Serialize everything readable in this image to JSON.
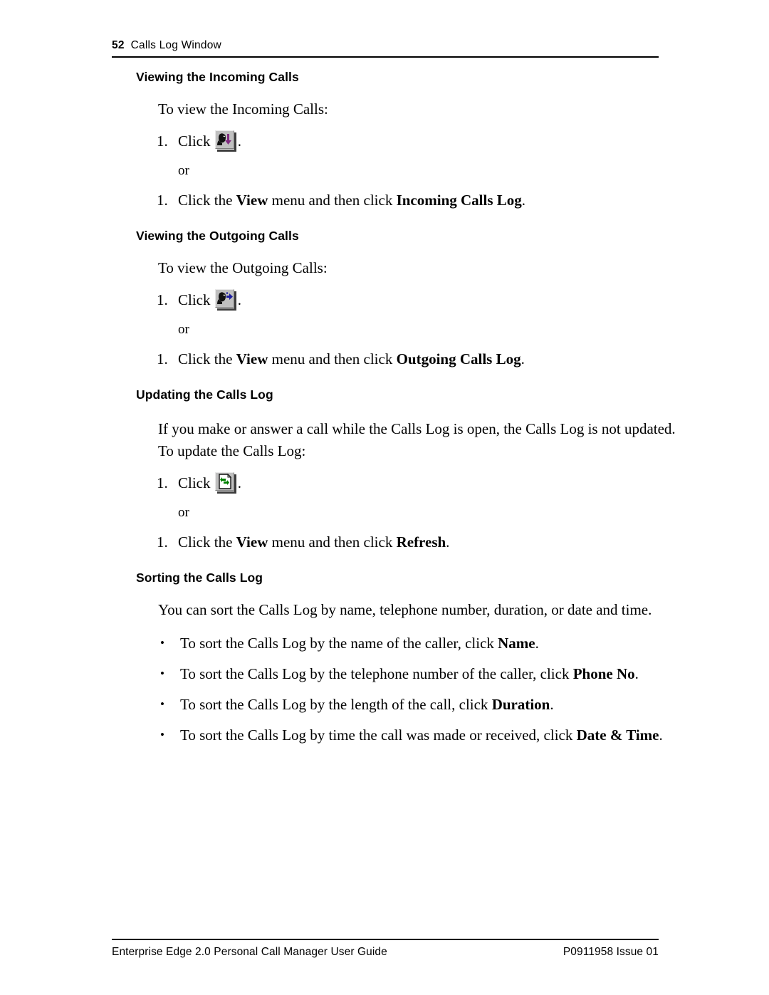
{
  "header": {
    "page_number": "52",
    "chapter_title": "Calls Log Window"
  },
  "sections": [
    {
      "heading": "Viewing the Incoming Calls",
      "intro": "To view the Incoming Calls:",
      "step_number": "1.",
      "step_click_label": "Click",
      "step_trailing": ".",
      "icon": "incoming-calls-log-icon",
      "or_label": "or",
      "alt_step_number": "1.",
      "alt_step_prefix": "Click the ",
      "alt_step_bold_1": "View",
      "alt_step_middle": " menu and then click ",
      "alt_step_bold_2": "Incoming Calls Log",
      "alt_step_suffix": "."
    },
    {
      "heading": "Viewing the Outgoing Calls",
      "intro": "To view the Outgoing Calls:",
      "step_number": "1.",
      "step_click_label": "Click",
      "step_trailing": ".",
      "icon": "outgoing-calls-log-icon",
      "or_label": "or",
      "alt_step_number": "1.",
      "alt_step_prefix": "Click the ",
      "alt_step_bold_1": "View",
      "alt_step_middle": " menu and then click ",
      "alt_step_bold_2": "Outgoing Calls Log",
      "alt_step_suffix": "."
    },
    {
      "heading": "Updating the Calls Log",
      "intro": "If you make or answer a call while the Calls Log is open, the Calls Log is not updated. To update the Calls Log:",
      "step_number": "1.",
      "step_click_label": "Click",
      "step_trailing": ".",
      "icon": "refresh-icon",
      "or_label": "or",
      "alt_step_number": "1.",
      "alt_step_prefix": "Click the ",
      "alt_step_bold_1": "View",
      "alt_step_middle": " menu and then click ",
      "alt_step_bold_2": "Refresh",
      "alt_step_suffix": "."
    }
  ],
  "sorting_section": {
    "heading": "Sorting the Calls Log",
    "intro": "You can sort the Calls Log by name, telephone number, duration, or date and time.",
    "bullet_glyph": "•",
    "bullets": [
      {
        "text": "To sort the Calls Log by the name of the caller, click ",
        "bold": "Name",
        "suffix": "."
      },
      {
        "text": "To sort the Calls Log by the telephone number of the caller, click ",
        "bold": "Phone No",
        "suffix": "."
      },
      {
        "text": "To sort the Calls Log by the length of the call, click ",
        "bold": "Duration",
        "suffix": "."
      },
      {
        "text": "To sort the Calls Log by time the call was made or received, click ",
        "bold": "Date & Time",
        "suffix": "."
      }
    ]
  },
  "footer": {
    "left": "Enterprise Edge 2.0 Personal Call Manager User Guide",
    "right": "P0911958 Issue 01"
  },
  "colors": {
    "button_face": "#c0c0c0",
    "incoming_arrow": "#802a80",
    "outgoing_arrow": "#1c1ca0",
    "refresh_arrow": "#008000",
    "rule": "#000000"
  }
}
